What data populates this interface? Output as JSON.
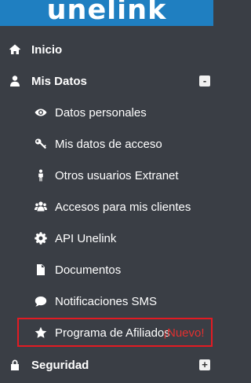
{
  "brand": {
    "logo_text": "unelink"
  },
  "menu": {
    "inicio": {
      "label": "Inicio",
      "icon": "home-icon"
    },
    "mis_datos": {
      "label": "Mis Datos",
      "icon": "user-icon",
      "toggle": "-"
    },
    "submenu": [
      {
        "label": "Datos personales",
        "icon": "eye-icon"
      },
      {
        "label": "Mis datos de acceso",
        "icon": "key-icon"
      },
      {
        "label": "Otros usuarios Extranet",
        "icon": "person-icon"
      },
      {
        "label": "Accesos para mis clientes",
        "icon": "users-icon"
      },
      {
        "label": "API Unelink",
        "icon": "gear-icon"
      },
      {
        "label": "Documentos",
        "icon": "document-icon"
      },
      {
        "label": "Notificaciones SMS",
        "icon": "chat-icon"
      },
      {
        "label": "Programa de Afiliados",
        "icon": "star-icon",
        "badge": "¡Nuevo!"
      }
    ],
    "seguridad": {
      "label": "Seguridad",
      "icon": "lock-icon",
      "toggle": "+"
    }
  },
  "colors": {
    "sidebar_bg": "#3a3e45",
    "brand_bar": "#1f7fc1",
    "highlight_border": "#e21b23",
    "badge_text": "#e33030"
  }
}
